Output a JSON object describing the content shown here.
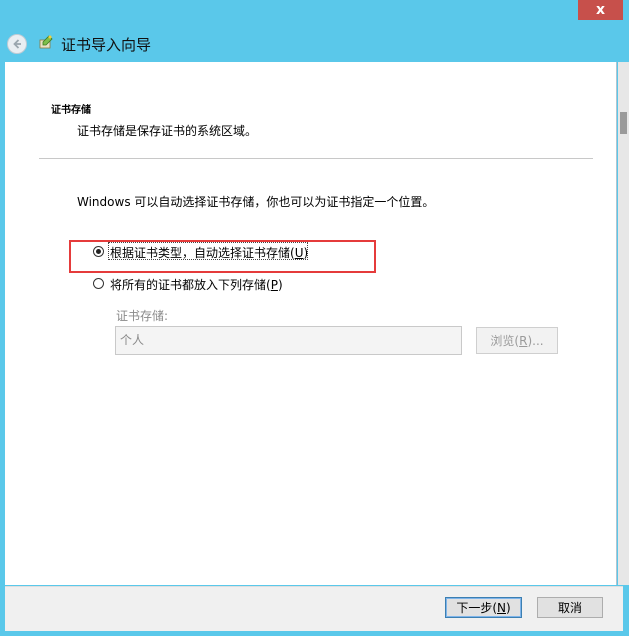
{
  "window": {
    "close_glyph": "x"
  },
  "header": {
    "title": "证书导入向导",
    "back_icon": "back-arrow-icon",
    "wizard_icon": "certificate-wizard-icon"
  },
  "section": {
    "title": "证书存储",
    "description": "证书存储是保存证书的系统区域。"
  },
  "intro": "Windows 可以自动选择证书存储，你也可以为证书指定一个位置。",
  "options": {
    "auto": {
      "label_text": "根据证书类型，自动选择证书存储(",
      "accel": "U",
      "label_suffix": ")",
      "checked": true
    },
    "manual": {
      "label_text": "将所有的证书都放入下列存储(",
      "accel": "P",
      "label_suffix": ")",
      "checked": false
    }
  },
  "store": {
    "label": "证书存储:",
    "value": "个人",
    "browse_text": "浏览(",
    "browse_accel": "R",
    "browse_suffix": ")..."
  },
  "footer": {
    "next": {
      "text": "下一步(",
      "accel": "N",
      "suffix": ")"
    },
    "cancel": "取消"
  },
  "colors": {
    "title_bar": "#5ac8ea",
    "highlight": "#e53b3b",
    "close": "#c7504b"
  }
}
